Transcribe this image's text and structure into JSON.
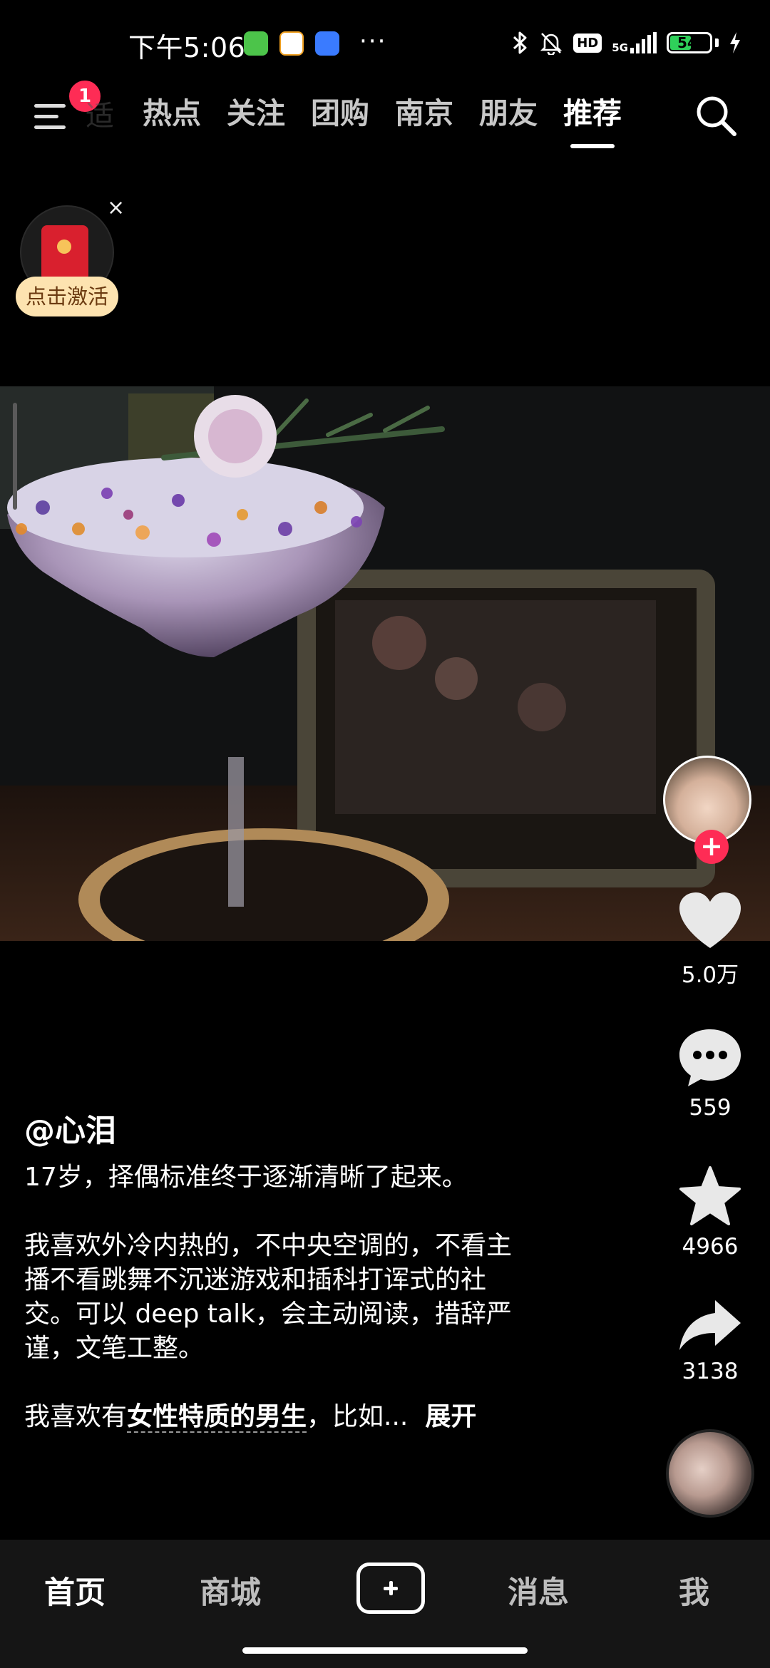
{
  "status_bar": {
    "time": "下午5:06",
    "more": "···",
    "hd": "HD",
    "network": "5G",
    "battery_percent": "54",
    "battery_level": 0.54
  },
  "top_nav": {
    "menu_badge": "1",
    "faded_label": "适",
    "tabs": [
      "热点",
      "关注",
      "团购",
      "南京",
      "朋友",
      "推荐"
    ],
    "active_tab": "推荐"
  },
  "red_packet": {
    "label": "点击激活",
    "close": "×"
  },
  "actions": {
    "likes": "5.0万",
    "comments": "559",
    "favorites": "4966",
    "shares": "3138",
    "follow": "+"
  },
  "caption": {
    "author": "@心泪",
    "line1": "17岁，择偶标准终于逐渐清晰了起来。",
    "line2": "我喜欢外冷内热的，不中央空调的，不看主",
    "line3": "播不看跳舞不沉迷游戏和插科打诨式的社",
    "line4": "交。可以 deep talk，会主动阅读，措辞严",
    "line5": "谨，文笔工整。",
    "line6_prefix": "我喜欢有",
    "line6_highlight": "女性特质的男生",
    "line6_suffix": "，比如...",
    "expand": "展开"
  },
  "bottom_bar": {
    "home": "首页",
    "mall": "商城",
    "messages": "消息",
    "me": "我"
  },
  "colors": {
    "accent": "#fe2c55",
    "background": "#000000",
    "tab_bar": "#151515",
    "battery": "#2fd05a"
  }
}
